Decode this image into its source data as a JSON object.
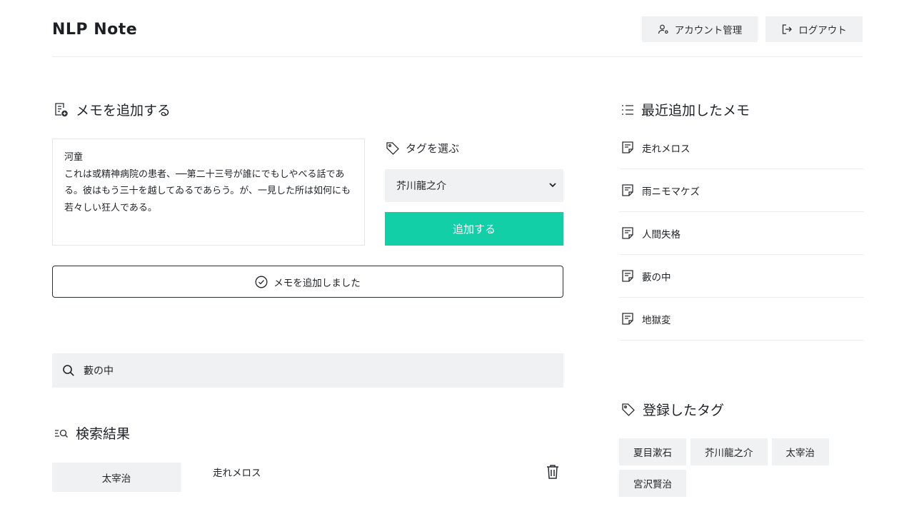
{
  "header": {
    "logo_text": "NLP Note",
    "account_label": "アカウント管理",
    "logout_label": "ログアウト"
  },
  "add_memo": {
    "title": "メモを追加する",
    "memo_title": "河童",
    "memo_body": "これは或精神病院の患者、──第二十三号が誰にでもしやべる話である。彼はもう三十を越してゐるであらう。が、一見した所は如何にも若々しい狂人である。",
    "tag_label": "タグを選ぶ",
    "selected_tag": "芥川龍之介",
    "add_button": "追加する",
    "success_message": "メモを追加しました"
  },
  "search": {
    "value": "藪の中",
    "results_title": "検索結果",
    "results": [
      {
        "tag": "太宰治",
        "title": "走れメロス"
      }
    ]
  },
  "recent": {
    "title": "最近追加したメモ",
    "items": [
      "走れメロス",
      "雨ニモマケズ",
      "人間失格",
      "藪の中",
      "地獄変"
    ]
  },
  "tags": {
    "title": "登録したタグ",
    "items": [
      "夏目漱石",
      "芥川龍之介",
      "太宰治",
      "宮沢賢治"
    ]
  },
  "colors": {
    "accent": "#12cfa7",
    "surface": "#f0f1f2",
    "text": "#1f2226"
  }
}
